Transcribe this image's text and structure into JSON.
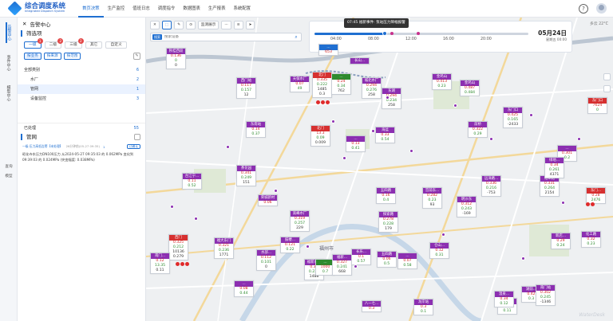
{
  "app": {
    "title": "综合调度系统",
    "subtitle": "Integrated Dispatch System"
  },
  "menu": [
    {
      "label": "首页决策",
      "active": true
    },
    {
      "label": "生产监控",
      "active": false
    },
    {
      "label": "值班日志",
      "active": false
    },
    {
      "label": "调度指令",
      "active": false
    },
    {
      "label": "数据图表",
      "active": false
    },
    {
      "label": "生产报表",
      "active": false
    },
    {
      "label": "系统配置",
      "active": false
    }
  ],
  "rail": {
    "alarm_center": "告警中心",
    "events": "事件中心",
    "model": "模型中心",
    "query": "查询",
    "model2": "模型"
  },
  "panel": {
    "header": "告警中心",
    "filter_title": "筛选项",
    "levels": [
      {
        "label": "一级",
        "badge": "1",
        "active": true
      },
      {
        "label": "二级",
        "badge": "2",
        "active": false
      },
      {
        "label": "三级",
        "badge": "2",
        "active": false
      },
      {
        "label": "其它",
        "badge": "",
        "active": false
      },
      {
        "label": "自定义",
        "badge": "",
        "active": false
      }
    ],
    "modes": [
      {
        "label": "按业务",
        "active": true
      },
      {
        "label": "按来源",
        "active": false
      },
      {
        "label": "按范围",
        "active": false
      }
    ],
    "categories": [
      {
        "label": "全部类别",
        "count": "6",
        "sub": false,
        "active": false
      },
      {
        "label": "水厂",
        "count": "2",
        "sub": true,
        "active": false
      },
      {
        "label": "管网",
        "count": "1",
        "sub": true,
        "active": true
      },
      {
        "label": "设备监控",
        "count": "3",
        "sub": true,
        "active": false
      }
    ],
    "handled_label": "已处理",
    "handled_count": "55",
    "alarm_title": "管网",
    "alarm_meta": {
      "tag": "一级·压力高低告警【未处理】",
      "time": "26分钟前(05-27 09:35)",
      "count": "1",
      "btn": "已确认"
    },
    "alarm_text": "昭化寺东压力DN100压力 从2024-05-27 09:35:03 的 0.062MPa 变化到 09:39:03 的 0.024MPa (突变幅度: 0.038MPa)"
  },
  "map": {
    "toolbar": [
      {
        "label": "✕",
        "name": "close-tool",
        "active": false
      },
      {
        "label": "⬚",
        "name": "select-tool",
        "active": true
      },
      {
        "label": "✎",
        "name": "draw-tool",
        "active": false
      },
      {
        "label": "⊙",
        "name": "locate-tool",
        "active": false
      },
      {
        "label": "监测展示",
        "name": "monitor-display",
        "active": false
      },
      {
        "label": "···",
        "name": "more-tool",
        "active": false
      },
      {
        "label": "≡",
        "name": "layer-tool",
        "active": false
      },
      {
        "label": "➤",
        "name": "navigate-tool",
        "active": false
      }
    ],
    "search": {
      "tag": "搜索",
      "placeholder": "搜索设备"
    },
    "timeline": {
      "event": "07:45 福新事件: 泵站压力降幅报警",
      "times": [
        "04:00",
        "08:00",
        "12:00",
        "16:00",
        "20:00"
      ],
      "progress": 0.33,
      "date": "05月24日",
      "date_sub": "星期五 00:00"
    },
    "weather": "多云 22°C",
    "watermark": "WaterDesk",
    "city_labels": [
      "福州市"
    ],
    "markers": [
      {
        "name": "秋桂西段",
        "color": "#8c2fb1",
        "vals": [
          "0.136",
          "0",
          "0"
        ]
      },
      {
        "name": "...",
        "color": "#1f6fd1",
        "vals": [
          "653",
          "",
          ""
        ]
      },
      {
        "name": "长山...",
        "color": "#8c2fb1",
        "vals": [
          "",
          "",
          ""
        ]
      },
      {
        "name": "天保水厂",
        "color": "#8c2fb1",
        "vals": [
          "0.07",
          "49"
        ]
      },
      {
        "name": "北门",
        "color": "#d63030",
        "vals": [
          "0.335",
          "0.222",
          "1485",
          "0.3"
        ]
      },
      {
        "name": "...",
        "color": "#2e8b2e",
        "vals": [
          "0.24",
          "0.34",
          "762"
        ]
      },
      {
        "name": "东湖",
        "color": "#8c2fb1",
        "vals": [
          "0.294",
          "0.234",
          "258"
        ]
      },
      {
        "name": "城北水厂",
        "color": "#8c2fb1",
        "vals": [
          "0.294",
          "0.276",
          "258"
        ]
      },
      {
        "name": "金鸡山",
        "color": "#8c2fb1",
        "vals": [
          "0.413",
          "0.23"
        ]
      },
      {
        "name": "金鸡山",
        "color": "#8c2fb1",
        "vals": [
          "0.487",
          "0.484"
        ]
      },
      {
        "name": "西门站",
        "color": "#8c2fb1",
        "vals": [
          "0.117",
          "0.157",
          "12"
        ]
      },
      {
        "name": "东南站",
        "color": "#8c2fb1",
        "vals": [
          "0.14",
          "0.37"
        ]
      },
      {
        "name": "北门",
        "color": "#d63030",
        "vals": [
          "13.3",
          "0.09",
          "0.009"
        ]
      },
      {
        "name": "海盆",
        "color": "#8c2fb1",
        "vals": [
          "0.33",
          "0.54"
        ]
      },
      {
        "name": "...",
        "color": "#8c2fb1",
        "vals": [
          "0.13",
          "0.41"
        ]
      },
      {
        "name": "东门口",
        "color": "#8c2fb1",
        "vals": [
          "0.425",
          "0.165",
          "-2433"
        ]
      },
      {
        "name": "前桥",
        "color": "#8c2fb1",
        "vals": [
          "0.322",
          "0.29"
        ]
      },
      {
        "name": "东门口",
        "color": "#d63030",
        "vals": [
          "7624",
          "0"
        ]
      },
      {
        "name": "...",
        "color": "#8c2fb1",
        "vals": [
          "0.301",
          "0.2"
        ]
      },
      {
        "name": "茶花园",
        "color": "#8c2fb1",
        "vals": [
          "0.341",
          "0.249",
          "151"
        ]
      },
      {
        "name": "台江宁...",
        "color": "#8c2fb1",
        "vals": [
          "0.11",
          "0.52"
        ]
      },
      {
        "name": "荣城新村",
        "color": "#8c2fb1",
        "vals": [
          "0.06"
        ]
      },
      {
        "name": "高峰水厂",
        "color": "#8c2fb1",
        "vals": [
          "0.319",
          "0.257",
          "229"
        ]
      },
      {
        "name": "五四路",
        "color": "#8c2fb1",
        "vals": [
          "0.16",
          "0.4"
        ]
      },
      {
        "name": "探索路",
        "color": "#8c2fb1",
        "vals": [
          "0.278",
          "0.228",
          "179"
        ]
      },
      {
        "name": "宫前东...",
        "color": "#8c2fb1",
        "vals": [
          "0.282",
          "0.23",
          "93"
        ]
      },
      {
        "name": "明沙东",
        "color": "#8c2fb1",
        "vals": [
          "0.312",
          "0.243",
          "-169"
        ]
      },
      {
        "name": "远洋路...",
        "color": "#8c2fb1",
        "vals": [
          "0.336",
          "0.216",
          "-753"
        ]
      },
      {
        "name": "化工路",
        "color": "#8c2fb1",
        "vals": [
          "0.331",
          "0.264",
          "2154"
        ]
      },
      {
        "name": "绿地...",
        "color": "#8c2fb1",
        "vals": [
          "0.34",
          "0.261",
          "4371"
        ]
      },
      {
        "name": "东门...",
        "color": "#d63030",
        "vals": [
          "0.28",
          "2476"
        ]
      },
      {
        "name": "西门",
        "color": "#d63030",
        "vals": [
          "0.325",
          "0.212",
          "10136",
          "0.279"
        ]
      },
      {
        "name": "福大东门",
        "color": "#8c2fb1",
        "vals": [
          "0.321",
          "0.236",
          "1771"
        ]
      },
      {
        "name": "水部...",
        "color": "#8c2fb1",
        "vals": [
          "0.112",
          "0.101",
          "0"
        ]
      },
      {
        "name": "鼓楼...",
        "color": "#8c2fb1",
        "vals": [
          "0.121",
          "0.22"
        ]
      },
      {
        "name": "福新水厂",
        "color": "#8c2fb1",
        "vals": [
          "0.37",
          "0.239",
          "1488"
        ]
      },
      {
        "name": "...",
        "color": "#2e8b2e",
        "vals": [
          "1000",
          "0.7"
        ]
      },
      {
        "name": "福新...",
        "color": "#8c2fb1",
        "vals": [
          "0.327",
          "0.241",
          "668"
        ]
      },
      {
        "name": "长乐...",
        "color": "#8c2fb1",
        "vals": [
          "0.1",
          "0.57"
        ]
      },
      {
        "name": "五四路",
        "color": "#8c2fb1",
        "vals": [
          "0.06",
          "0.5"
        ]
      },
      {
        "name": "...",
        "color": "#8c2fb1",
        "vals": [
          "0.07",
          "0.58"
        ]
      },
      {
        "name": "仓山...",
        "color": "#8c2fb1",
        "vals": [
          "0.12",
          "0.31"
        ]
      },
      {
        "name": "南门...",
        "color": "#8c2fb1",
        "vals": [
          "0.12",
          "13.35",
          "0.11"
        ]
      },
      {
        "name": "...",
        "color": "#8c2fb1",
        "vals": [
          "0.08",
          "0.44"
        ]
      },
      {
        "name": "化工路",
        "color": "#8c2fb1",
        "vals": [
          "0.32",
          "0.23"
        ]
      },
      {
        "name": "新店...",
        "color": "#8c2fb1",
        "vals": [
          "0.29",
          "0.24"
        ]
      },
      {
        "name": "湖前...",
        "color": "#8c2fb1",
        "vals": [
          "0.42",
          "0.3"
        ]
      },
      {
        "name": "...",
        "color": "#8c2fb1",
        "vals": [
          "0.09",
          "0.11"
        ]
      },
      {
        "name": "八一七...",
        "color": "#8c2fb1",
        "vals": [
          "0.3"
        ]
      },
      {
        "name": "龙岸站",
        "color": "#8c2fb1",
        "vals": [
          "0.3",
          "0.1"
        ]
      },
      {
        "name": "南门站",
        "color": "#8c2fb1",
        "vals": [
          "0.302",
          "0.245",
          "-1346"
        ]
      },
      {
        "name": "温泉...",
        "color": "#8c2fb1",
        "vals": [
          "0.34",
          "0.12"
        ]
      }
    ]
  }
}
